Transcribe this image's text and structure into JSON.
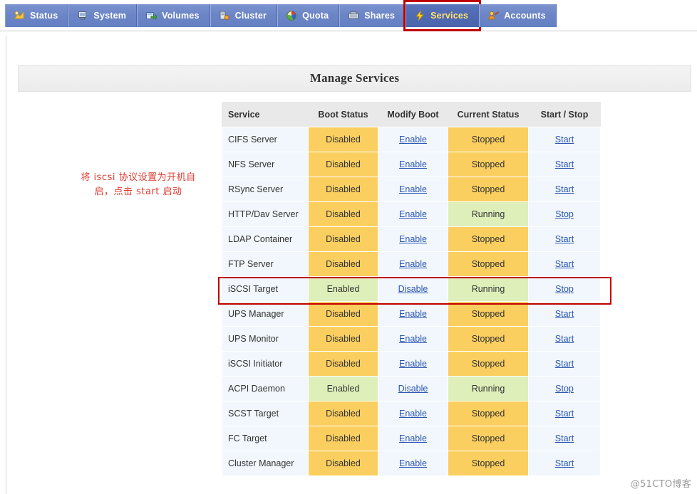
{
  "nav": {
    "tabs": [
      {
        "label": "Status",
        "icon": "status-icon",
        "active": false
      },
      {
        "label": "System",
        "icon": "system-icon",
        "active": false
      },
      {
        "label": "Volumes",
        "icon": "volumes-icon",
        "active": false
      },
      {
        "label": "Cluster",
        "icon": "cluster-icon",
        "active": false
      },
      {
        "label": "Quota",
        "icon": "quota-icon",
        "active": false
      },
      {
        "label": "Shares",
        "icon": "shares-icon",
        "active": false
      },
      {
        "label": "Services",
        "icon": "services-icon",
        "active": true
      },
      {
        "label": "Accounts",
        "icon": "accounts-icon",
        "active": false
      }
    ],
    "highlighted_tab": "Services"
  },
  "page": {
    "title": "Manage Services"
  },
  "annotation": {
    "line1": "将 iscsi 协议设置为开机自",
    "line2": "启，点击 start 启动",
    "color": "#e03a2f"
  },
  "table": {
    "columns": [
      "Service",
      "Boot Status",
      "Modify Boot",
      "Current Status",
      "Start / Stop"
    ],
    "rows": [
      {
        "service": "CIFS Server",
        "boot": "Disabled",
        "boot_state": "off",
        "modify": "Enable",
        "current": "Stopped",
        "current_state": "off",
        "action": "Start"
      },
      {
        "service": "NFS Server",
        "boot": "Disabled",
        "boot_state": "off",
        "modify": "Enable",
        "current": "Stopped",
        "current_state": "off",
        "action": "Start"
      },
      {
        "service": "RSync Server",
        "boot": "Disabled",
        "boot_state": "off",
        "modify": "Enable",
        "current": "Stopped",
        "current_state": "off",
        "action": "Start"
      },
      {
        "service": "HTTP/Dav Server",
        "boot": "Disabled",
        "boot_state": "off",
        "modify": "Enable",
        "current": "Running",
        "current_state": "on",
        "action": "Stop"
      },
      {
        "service": "LDAP Container",
        "boot": "Disabled",
        "boot_state": "off",
        "modify": "Enable",
        "current": "Stopped",
        "current_state": "off",
        "action": "Start"
      },
      {
        "service": "FTP Server",
        "boot": "Disabled",
        "boot_state": "off",
        "modify": "Enable",
        "current": "Stopped",
        "current_state": "off",
        "action": "Start"
      },
      {
        "service": "iSCSI Target",
        "boot": "Enabled",
        "boot_state": "on",
        "modify": "Disable",
        "current": "Running",
        "current_state": "on",
        "action": "Stop"
      },
      {
        "service": "UPS Manager",
        "boot": "Disabled",
        "boot_state": "off",
        "modify": "Enable",
        "current": "Stopped",
        "current_state": "off",
        "action": "Start"
      },
      {
        "service": "UPS Monitor",
        "boot": "Disabled",
        "boot_state": "off",
        "modify": "Enable",
        "current": "Stopped",
        "current_state": "off",
        "action": "Start"
      },
      {
        "service": "iSCSI Initiator",
        "boot": "Disabled",
        "boot_state": "off",
        "modify": "Enable",
        "current": "Stopped",
        "current_state": "off",
        "action": "Start"
      },
      {
        "service": "ACPI Daemon",
        "boot": "Enabled",
        "boot_state": "on",
        "modify": "Disable",
        "current": "Running",
        "current_state": "on",
        "action": "Stop"
      },
      {
        "service": "SCST Target",
        "boot": "Disabled",
        "boot_state": "off",
        "modify": "Enable",
        "current": "Stopped",
        "current_state": "off",
        "action": "Start"
      },
      {
        "service": "FC Target",
        "boot": "Disabled",
        "boot_state": "off",
        "modify": "Enable",
        "current": "Stopped",
        "current_state": "off",
        "action": "Start"
      },
      {
        "service": "Cluster Manager",
        "boot": "Disabled",
        "boot_state": "off",
        "modify": "Enable",
        "current": "Stopped",
        "current_state": "off",
        "action": "Start"
      }
    ],
    "highlighted_row": "iSCSI Target"
  },
  "colors": {
    "tab_bar": "#6c85c6",
    "tab_active": "#4f6ab3",
    "tab_active_text": "#ffe06a",
    "state_off": "#fbcf5f",
    "state_on": "#deefba",
    "row_bg": "#f1f7fc",
    "header_bg": "#e9e9e9",
    "link": "#2b55b4",
    "highlight_border": "#c00000"
  },
  "watermark": {
    "text": "@51CTO博客"
  }
}
